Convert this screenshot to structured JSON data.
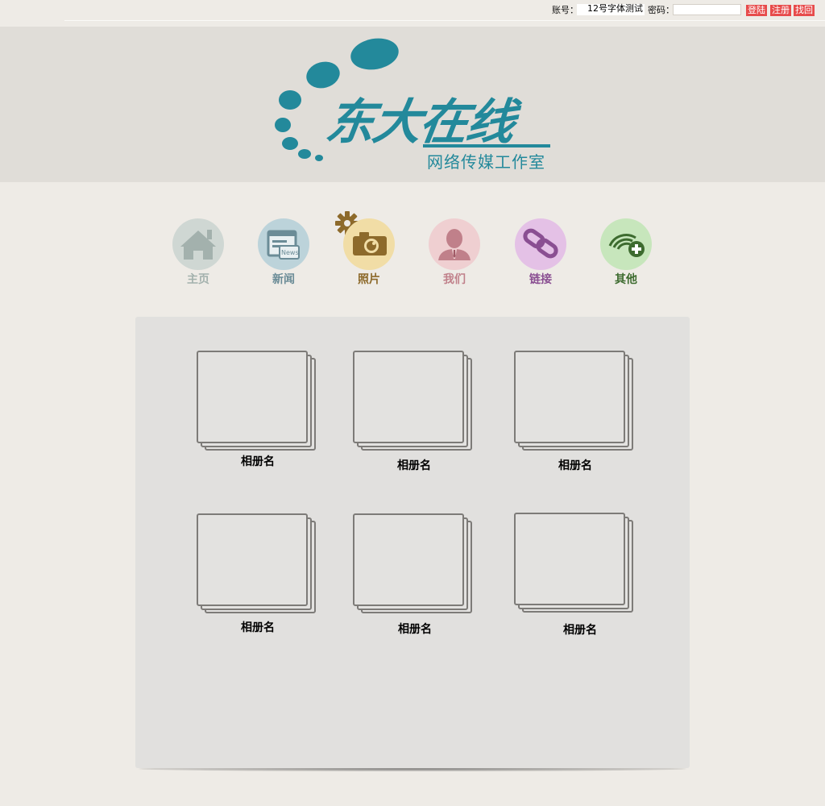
{
  "login": {
    "account_label": "账号：",
    "account_value": "12号字体测试",
    "password_label": "密码：",
    "password_value": "",
    "login_label": "登陆",
    "register_label": "注册",
    "recover_label": "找回"
  },
  "brand": {
    "title": "东大在线",
    "subtitle": "网络传媒工作室",
    "color": "#23899b"
  },
  "nav": [
    {
      "label": "主页",
      "icon": "house-icon",
      "bg": "#cfd7d3",
      "fg": "#9fb0ab"
    },
    {
      "label": "新闻",
      "icon": "news-icon",
      "bg": "#bcd3da",
      "fg": "#6b8c97"
    },
    {
      "label": "照片",
      "icon": "camera-icon",
      "bg": "#f1dda6",
      "fg": "#8d6a2b"
    },
    {
      "label": "我们",
      "icon": "person-icon",
      "bg": "#efcfd1",
      "fg": "#c0808a"
    },
    {
      "label": "链接",
      "icon": "link-icon",
      "bg": "#e4c1e6",
      "fg": "#8a4f92"
    },
    {
      "label": "其他",
      "icon": "rss-add-icon",
      "bg": "#c7e6bc",
      "fg": "#3d6b2f"
    }
  ],
  "albums": [
    {
      "name": "相册名"
    },
    {
      "name": "相册名"
    },
    {
      "name": "相册名"
    },
    {
      "name": "相册名"
    },
    {
      "name": "相册名"
    },
    {
      "name": "相册名"
    }
  ]
}
